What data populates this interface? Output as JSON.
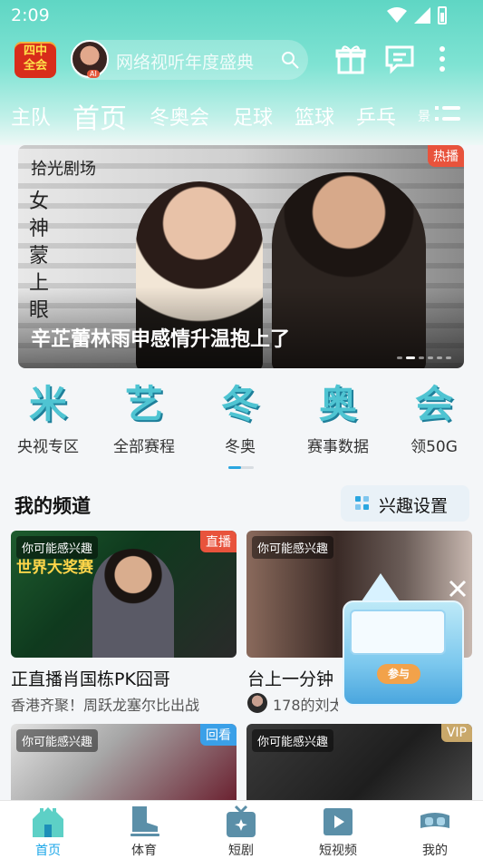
{
  "status_bar": {
    "time": "2:09"
  },
  "header": {
    "logo_text": "四中\n全会",
    "ai_badge": "AI",
    "search_placeholder": "网络视听年度盛典"
  },
  "tabs": [
    {
      "label": "主队",
      "active": false
    },
    {
      "label": "首页",
      "active": true
    },
    {
      "label": "冬奥会",
      "active": false
    },
    {
      "label": "足球",
      "active": false
    },
    {
      "label": "篮球",
      "active": false
    },
    {
      "label": "乒乓",
      "active": false
    },
    {
      "label": "景",
      "active": false
    }
  ],
  "banner": {
    "brand": "拾光剧场",
    "art_title": "女神蒙上眼",
    "badge": "热播",
    "caption": "辛芷蕾林雨申感情升温抱上了",
    "dot_count": 6,
    "active_dot": 1
  },
  "quick_entries": [
    {
      "glyph": "米",
      "label": "央视专区"
    },
    {
      "glyph": "艺",
      "label": "全部赛程"
    },
    {
      "glyph": "冬",
      "label": "冬奥"
    },
    {
      "glyph": "奥",
      "label": "赛事数据"
    },
    {
      "glyph": "会",
      "label": "领50G"
    }
  ],
  "channels": {
    "title": "我的频道",
    "interest_button": "兴趣设置",
    "cards": [
      {
        "tag": "你可能感兴趣",
        "badge": "直播",
        "badge_color": "#e8533c",
        "logo": "世界大奖赛",
        "title": "正直播肖国栋PK囧哥",
        "subtitle": "香港齐聚！周跃龙塞尔比出战"
      },
      {
        "tag": "你可能感兴趣",
        "badge": "",
        "title": "台上一分钟",
        "subtitle": "178的刘太阳"
      },
      {
        "tag": "你可能感兴趣",
        "badge": "回看",
        "badge_color": "#3aa0e8",
        "title": "",
        "subtitle": ""
      },
      {
        "tag": "你可能感兴趣",
        "badge": "VIP",
        "badge_color": "#c9a86a",
        "title": "",
        "subtitle": ""
      }
    ]
  },
  "float_ad": {
    "button": "参与"
  },
  "bottom_nav": [
    {
      "label": "首页",
      "active": true
    },
    {
      "label": "体育",
      "active": false
    },
    {
      "label": "短剧",
      "active": false
    },
    {
      "label": "短视频",
      "active": false
    },
    {
      "label": "我的",
      "active": false
    }
  ],
  "colors": {
    "accent": "#1aa6e8",
    "header_gradient": "#5fd6c4",
    "live_badge": "#e8533c"
  }
}
